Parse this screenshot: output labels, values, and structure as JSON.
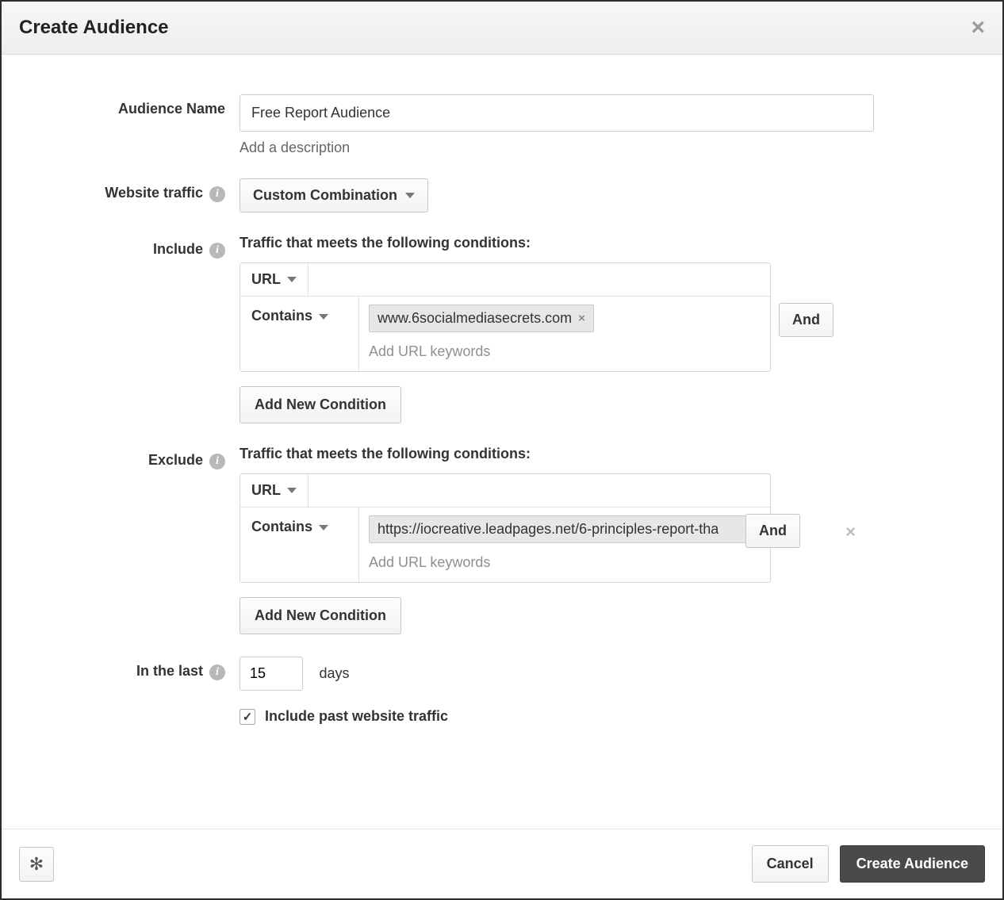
{
  "header": {
    "title": "Create Audience"
  },
  "labels": {
    "audience_name": "Audience Name",
    "website_traffic": "Website traffic",
    "include": "Include",
    "exclude": "Exclude",
    "in_the_last": "In the last"
  },
  "audience_name": {
    "value": "Free Report Audience",
    "description_link": "Add a description"
  },
  "website_traffic_select": "Custom Combination",
  "include": {
    "description": "Traffic that meets the following conditions:",
    "url_select": "URL",
    "contains_select": "Contains",
    "chips": [
      "www.6socialmediasecrets.com"
    ],
    "placeholder": "Add URL keywords",
    "and_button": "And",
    "add_new_condition": "Add New Condition"
  },
  "exclude": {
    "description": "Traffic that meets the following conditions:",
    "url_select": "URL",
    "contains_select": "Contains",
    "chips": [
      "https://iocreative.leadpages.net/6-principles-report-tha"
    ],
    "placeholder": "Add URL keywords",
    "and_button": "And",
    "add_new_condition": "Add New Condition"
  },
  "in_the_last": {
    "value": "15",
    "unit": "days"
  },
  "include_past_traffic": {
    "checked": true,
    "label": "Include past website traffic"
  },
  "footer": {
    "cancel": "Cancel",
    "create": "Create Audience"
  }
}
